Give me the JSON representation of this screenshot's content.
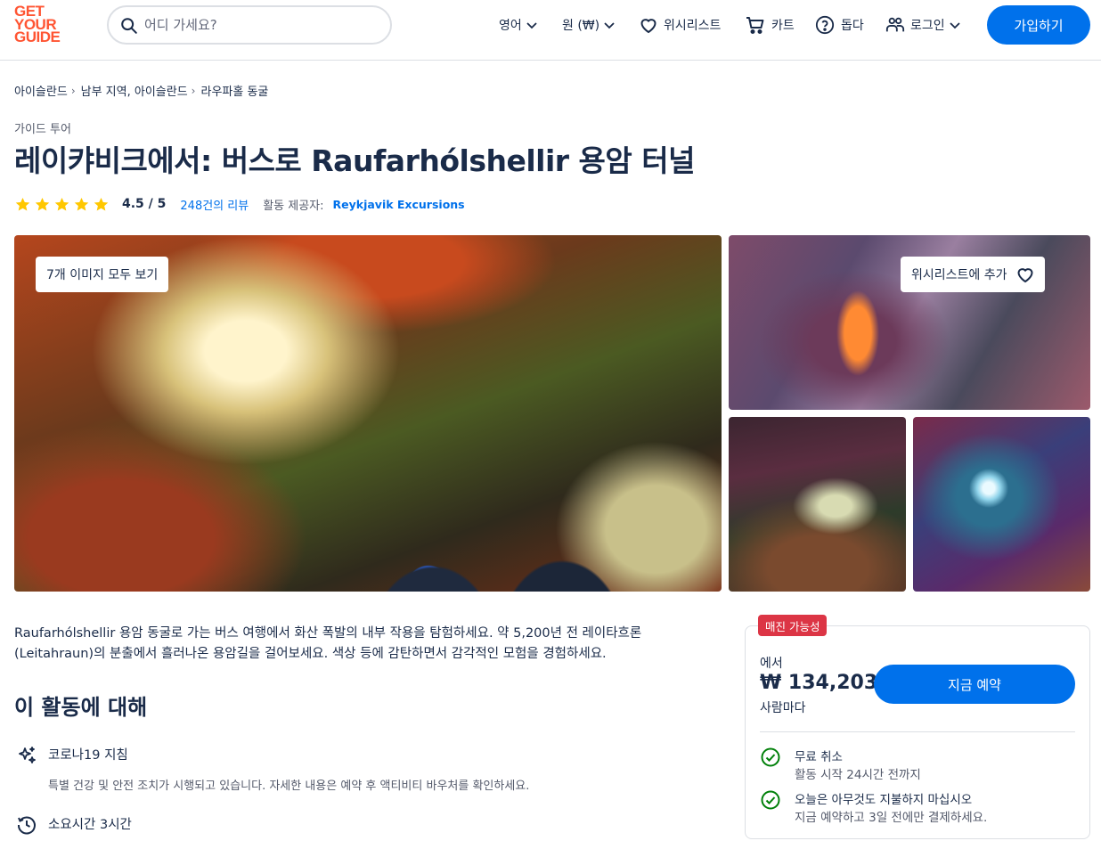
{
  "header": {
    "logo": [
      "GET",
      "YOUR",
      "GUIDE"
    ],
    "search_placeholder": "어디 가세요?",
    "language": "영어",
    "currency": "원 (₩)",
    "wishlist": "위시리스트",
    "cart": "카트",
    "help": "돕다",
    "login": "로그인",
    "signup": "가입하기"
  },
  "breadcrumb": [
    "아이슬란드",
    "남부 지역, 아이슬란드",
    "라우파홀 동굴"
  ],
  "category": "가이드 투어",
  "title": "레이캬비크에서: 버스로 Raufarhólshellir 용암 터널",
  "rating": {
    "stars": 5,
    "value": "4.5 / 5",
    "reviews": "248건의 리뷰",
    "provider_label": "활동 제공자:",
    "provider": "Reykjavik Excursions"
  },
  "gallery": {
    "all_images": "7개 이미지 모두 보기",
    "add_wishlist": "위시리스트에 추가"
  },
  "description": "Raufarhólshellir 용암 동굴로 가는 버스 여행에서 화산 폭발의 내부 작용을 탐험하세요. 약 5,200년 전 레이타흐론(Leitahraun)의 분출에서 흘러나온 용암길을 걸어보세요. 색상 등에 감탄하면서 감각적인 모험을 경험하세요.",
  "about": {
    "title": "이 활동에 대해",
    "items": [
      {
        "title": "코로나19 지침",
        "text": "특별 건강 및 안전 조치가 시행되고 있습니다. 자세한 내용은 예약 후 액티비티 바우처를 확인하세요."
      },
      {
        "title": "소요시간 3시간",
        "text": ""
      }
    ]
  },
  "booking": {
    "badge": "매진 가능성",
    "from": "에서",
    "price": "₩ 134,203",
    "per_person": "사람마다",
    "book_now": "지금 예약",
    "perks": [
      {
        "title": "무료 취소",
        "text": "활동 시작 24시간 전까지"
      },
      {
        "title": "오늘은 아무것도 지불하지 마십시오",
        "text": "지금 예약하고 3일 전에만 결제하세요."
      }
    ]
  },
  "colors": {
    "brand": "#ff5533",
    "accent": "#0071eb",
    "text": "#1a2b49",
    "star": "#ffc700",
    "badge": "#dc3545",
    "check": "#008009"
  }
}
